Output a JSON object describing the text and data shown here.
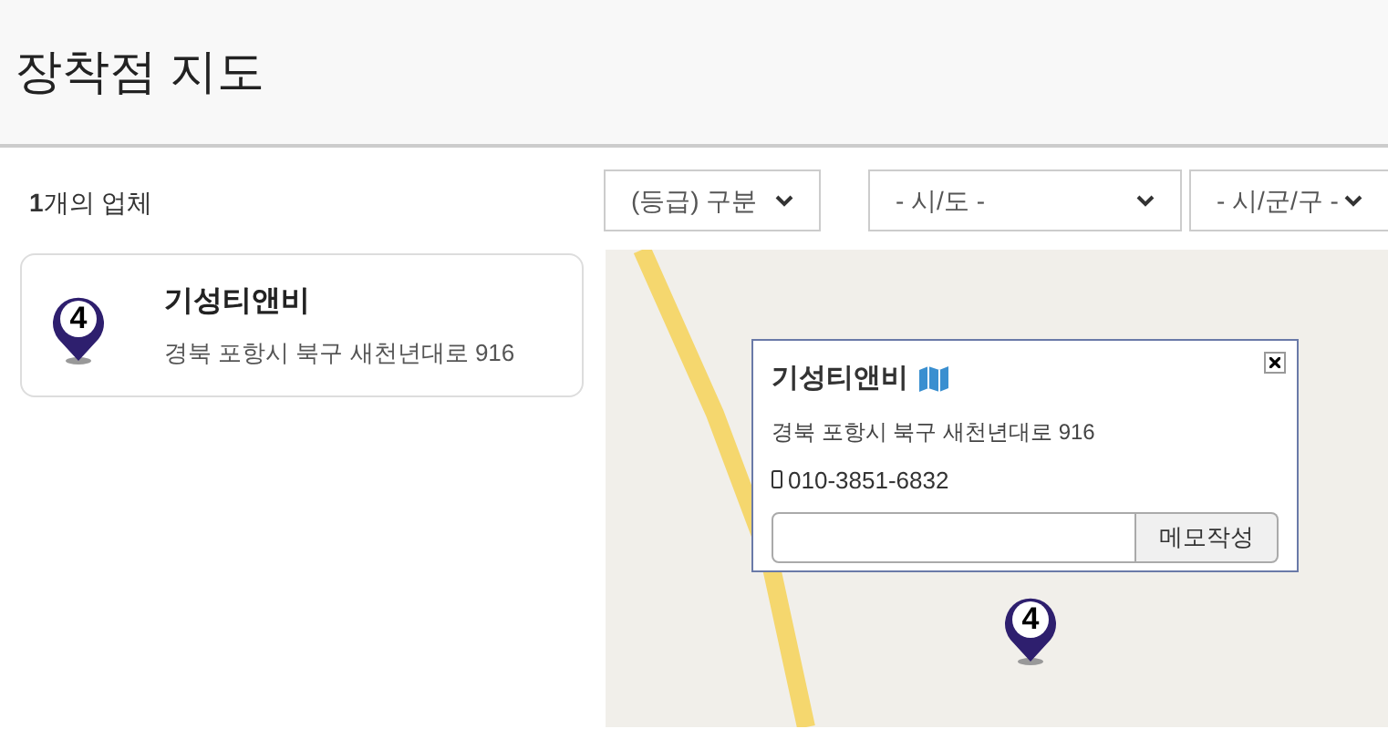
{
  "page_title": "장착점 지도",
  "result_count": "**1**개의 업체",
  "filters": [
    {
      "label": "(등급) 구분"
    },
    {
      "label": "- 시/도 -"
    },
    {
      "label": "- 시/군/구 -"
    }
  ],
  "shops": [
    {
      "name": "기성티앤비",
      "address": "경북 포항시 북구 새천년대로 916",
      "badge": "4"
    }
  ],
  "map": {
    "marker": "4",
    "popup": {
      "name": "기성티앤비",
      "address": "경북 포항시 북구 새천년대로 916",
      "phone": "010-3851-6832",
      "memo_button": "메모작성"
    }
  }
}
